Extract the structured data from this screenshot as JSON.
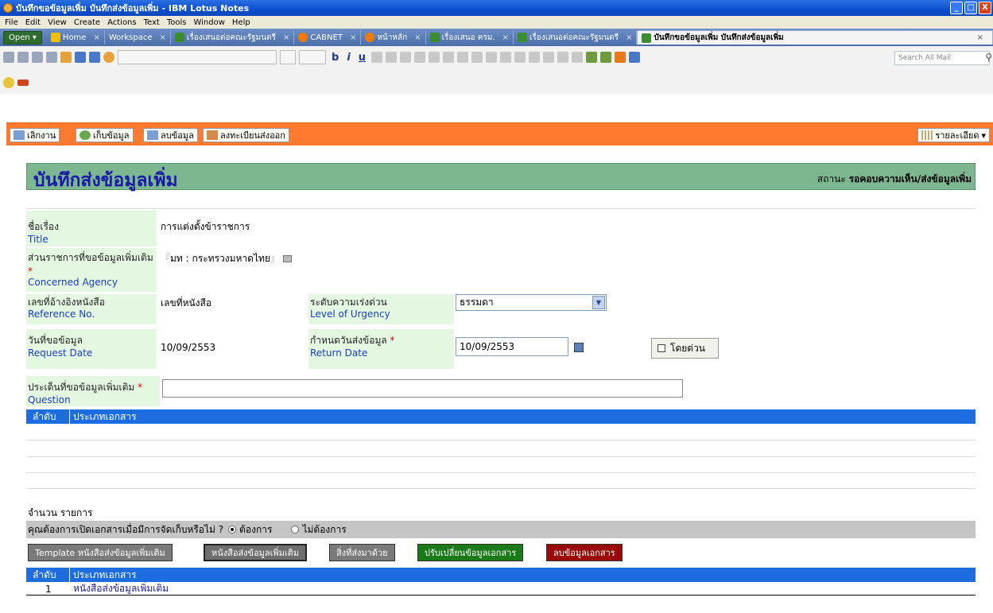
{
  "window": {
    "title": "บันทึกขอข้อมูลเพิ่ม บันทึกส่งข้อมูลเพิ่ม - IBM Lotus Notes",
    "controls": [
      "_",
      "□",
      "X"
    ]
  },
  "menu": [
    "File",
    "Edit",
    "View",
    "Create",
    "Actions",
    "Text",
    "Tools",
    "Window",
    "Help"
  ],
  "tabs": {
    "open_label": "Open",
    "items": [
      {
        "label": "Home",
        "icon_color": "#f0c000"
      },
      {
        "label": "Workspace",
        "icon_color": "#8a8a8a"
      },
      {
        "label": "เรื่องเสนอต่อคณะรัฐมนตรี",
        "icon_color": "#3b8c2e"
      },
      {
        "label": "CABNET",
        "icon_color": "#f07a00"
      },
      {
        "label": "หน้าหลัก",
        "icon_color": "#f07a00"
      },
      {
        "label": "เรื่องเสนอ ครม.",
        "icon_color": "#3b8c2e"
      },
      {
        "label": "เรื่องเสนอต่อคณะรัฐมนตรี",
        "icon_color": "#3b8c2e"
      }
    ],
    "active": "บันทึกขอข้อมูลเพิ่ม บันทึกส่งข้อมูลเพิ่ม",
    "close_glyph": "×"
  },
  "toolbar": {
    "search_placeholder": "Search All Mail",
    "format_glyphs": [
      "b",
      "i",
      "u"
    ]
  },
  "actions": {
    "items": [
      "เลิกงาน",
      "เก็บข้อมูล",
      "ลบข้อมูล",
      "ลงทะเบียนส่งออก"
    ],
    "detail": "รายละเอียด"
  },
  "form": {
    "title": "บันทึกส่งข้อมูลเพิ่ม",
    "status_label": "สถานะ",
    "status_value": "รอคอบความเห็น/ส่งข้อมูลเพิ่ม",
    "subject_th": "ชื่อเรื่อง",
    "subject_en": "Title",
    "subject_value": "การแต่งตั้งข้าราชการ",
    "agency_th": "ส่วนราชการที่ขอข้อมูลเพิ่มเติม",
    "agency_en": "Concerned Agency",
    "agency_value": "มท : กระทรวงมหาดไทย",
    "ref_th": "เลขที่อ้างอิงหนังสือ",
    "ref_en": "Reference No.",
    "ref_value": "เลขที่หนังสือ",
    "urgency_th": "ระดับความเร่งด่วน",
    "urgency_en": "Level of Urgency",
    "urgency_value": "ธรรมดา",
    "reqdate_th": "วันที่ขอข้อมูล",
    "reqdate_en": "Request Date",
    "reqdate_value": "10/09/2553",
    "retdate_th": "กำหนดวันส่งข้อมูล",
    "retdate_en": "Return Date",
    "retdate_value": "10/09/2553",
    "urgent_check": "โดยด่วน",
    "question_th": "ประเด็นที่ขอข้อมูลเพิ่มเติม",
    "question_en": "Question",
    "question_value": "",
    "required_mark": "*"
  },
  "table1": {
    "col1": "ลำดับ",
    "col2": "ประเภทเอกสาร"
  },
  "count": {
    "label": "จำนวน",
    "unit": "รายการ",
    "value": ""
  },
  "open_question": {
    "text": "คุณต้องการเปิดเอกสารเมื่อมีการจัดเก็บหรือไม่ ?",
    "yes": "ต้องการ",
    "no": "ไม่ต้องการ",
    "selected": "yes"
  },
  "doc_buttons": [
    {
      "label": "Template หนังสือส่งข้อมูลเพิ่มเติม",
      "color": "#7a7a7a"
    },
    {
      "label": "หนังสือส่งข้อมูลเพิ่มเติม",
      "color": "#6e6e6e"
    },
    {
      "label": "สิ่งที่ส่งมาด้วย",
      "color": "#7a7a7a"
    },
    {
      "label": "ปรับเปลี่ยนข้อมูลเอกสาร",
      "color": "#1a7a1a"
    },
    {
      "label": "ลบข้อมูลเอกสาร",
      "color": "#9a0a0a"
    }
  ],
  "table2": {
    "col1": "ลำดับ",
    "col2": "ประเภทเอกสาร",
    "rows": [
      {
        "no": "1",
        "name": "หนังสือส่งข้อมูลเพิ่มเติม"
      }
    ]
  }
}
